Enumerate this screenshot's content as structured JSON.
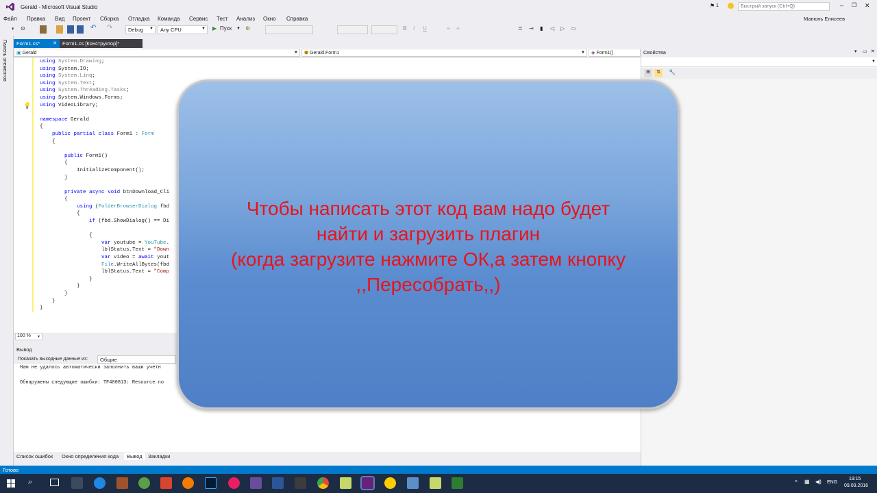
{
  "window": {
    "title": "Gerald - Microsoft Visual Studio",
    "notifications": "1",
    "quick_launch_placeholder": "Быстрый запуск (Ctrl+Q)",
    "user": "Манюнь Елисеев"
  },
  "menu": [
    "Файл",
    "Правка",
    "Вид",
    "Проект",
    "Сборка",
    "Отладка",
    "Команда",
    "Сервис",
    "Тест",
    "Анализ",
    "Окно",
    "Справка"
  ],
  "toolbar": {
    "config": "Debug",
    "platform": "Any CPU",
    "run_label": "Пуск"
  },
  "sidebar": {
    "label": "Панель элементов"
  },
  "tabs": [
    {
      "label": "Form1.cs*",
      "active": true
    },
    {
      "label": "Form1.cs [Конструктор]*",
      "active": false
    }
  ],
  "nav": {
    "project": "Gerald",
    "class": "Gerald.Form1",
    "member": "Form1()"
  },
  "code_lines": [
    "using System.Drawing;",
    "using System.IO;",
    "using System.Linq;",
    "using System.Text;",
    "using System.Threading.Tasks;",
    "using System.Windows.Forms;",
    "using VideoLibrary;",
    "",
    "namespace Gerald",
    "{",
    "    public partial class Form1 : Form",
    "    {",
    "",
    "        public Form1()",
    "        {",
    "            InitializeComponent();",
    "        }",
    "",
    "        private async void btnDownload_Cli",
    "        {",
    "            using (FolderBrowserDialog fbd",
    "            {",
    "                if (fbd.ShowDialog() == Di",
    "",
    "                {",
    "                    var youtube = YouTube.",
    "                    lblStatus.Text = \"Down",
    "                    var video = await yout",
    "                    File.WriteAllBytes(fbd",
    "                    lblStatus.Text = \"Comp",
    "                }",
    "            }",
    "        }",
    "    }",
    "}"
  ],
  "zoom": "100 %",
  "output": {
    "title": "Вывод",
    "show_from_label": "Показать выходные данные из:",
    "show_from_value": "Общие",
    "lines": [
      "Нам не удалось автоматически заполнить ваши учетн",
      "",
      "Обнаружены следующие ошибки: TF400813: Resource no"
    ]
  },
  "bottom_tabs": [
    "Список ошибок",
    "Окно определения кода",
    "Вывод",
    "Закладки"
  ],
  "properties": {
    "title": "Свойства"
  },
  "status": {
    "text": "Готово"
  },
  "taskbar": {
    "lang": "ENG",
    "time": "19:15",
    "date": "09.09.2016"
  },
  "overlay": {
    "lines": [
      "Чтобы написать этот код вам надо будет",
      "найти и загрузить плагин",
      "(когда загрузите нажмите ОК,а затем кнопку",
      ",,Пересобрать,,)"
    ]
  }
}
